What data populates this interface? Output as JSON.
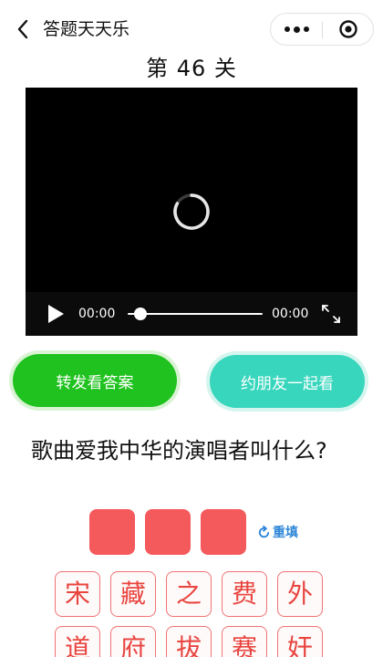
{
  "nav": {
    "title": "答题天天乐"
  },
  "level": {
    "title": "第 46 关"
  },
  "video": {
    "current_time": "00:00",
    "duration": "00:00",
    "progress": 0
  },
  "actions": {
    "share_label": "转发看答案",
    "invite_label": "约朋友一起看"
  },
  "question": {
    "text": "歌曲爱我中华的演唱者叫什么?"
  },
  "answer": {
    "slot_count": 3,
    "refill_label": "重填"
  },
  "candidates": [
    [
      "宋",
      "藏",
      "之",
      "费",
      "外"
    ],
    [
      "道",
      "府",
      "拔",
      "赛",
      "奸"
    ]
  ],
  "colors": {
    "share_button": "#20c21f",
    "invite_button": "#38d6bd",
    "answer_slot": "#f4595b",
    "candidate_text": "#e8453f",
    "refill_link": "#2d86d8"
  }
}
